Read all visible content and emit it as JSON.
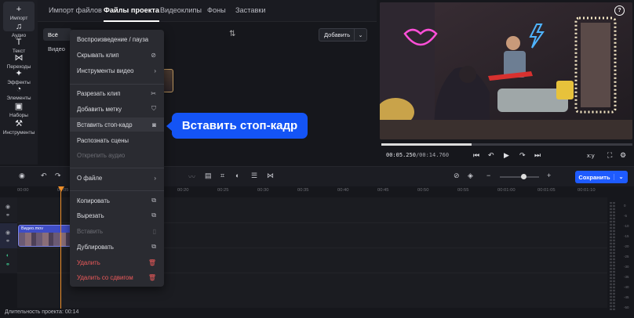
{
  "sidebar": {
    "items": [
      {
        "label": "Импорт",
        "icon": "plus-icon",
        "glyph": "+"
      },
      {
        "label": "Аудио",
        "icon": "music-note-icon",
        "glyph": "♫"
      },
      {
        "label": "Текст",
        "icon": "text-icon",
        "glyph": "T"
      },
      {
        "label": "Переходы",
        "icon": "transitions-icon",
        "glyph": "⋈"
      },
      {
        "label": "Эффекты",
        "icon": "effects-icon",
        "glyph": "✦"
      },
      {
        "label": "Элементы",
        "icon": "elements-icon",
        "glyph": "◔"
      },
      {
        "label": "Наборы",
        "icon": "sets-icon",
        "glyph": "▣"
      },
      {
        "label": "Инструменты",
        "icon": "tools-icon",
        "glyph": "⚒"
      }
    ]
  },
  "topnav": {
    "tabs": [
      "Импорт файлов",
      "Файлы проекта",
      "Видеоклипы",
      "Фоны",
      "Заставки"
    ],
    "active": 1
  },
  "library": {
    "filter": "Всё",
    "video_label": "Видео",
    "add_button": "Добавить"
  },
  "context_menu": {
    "items": [
      {
        "label": "Воспроизведение / пауза",
        "icon": ""
      },
      {
        "label": "Скрывать клип",
        "icon": "⊘"
      },
      {
        "label": "Инструменты видео",
        "icon": "›"
      },
      {
        "label": "Разрезать клип",
        "icon": "✂"
      },
      {
        "label": "Добавить метку",
        "icon": "⛉"
      },
      {
        "label": "Вставить стоп-кадр",
        "icon": "◙"
      },
      {
        "label": "Распознать сцены",
        "icon": ""
      },
      {
        "label": "Открепить аудио",
        "icon": ""
      },
      {
        "label": "О файле",
        "icon": "›"
      },
      {
        "label": "Копировать",
        "icon": "⧉"
      },
      {
        "label": "Вырезать",
        "icon": "⧉"
      },
      {
        "label": "Вставить",
        "icon": "▯"
      },
      {
        "label": "Дублировать",
        "icon": "⧉"
      },
      {
        "label": "Удалить",
        "icon": "🗑"
      },
      {
        "label": "Удалить со сдвигом",
        "icon": "🗑"
      }
    ]
  },
  "tooltip": "Вставить стоп-кадр",
  "player": {
    "timecode_current": "00:05.250",
    "timecode_total": "00:14.760",
    "aspect": "x:y",
    "progress": 0.36
  },
  "timeline": {
    "save_label": "Сохранить",
    "ruler": [
      "00:00",
      "00:05",
      "00:10",
      "00:15",
      "00:20",
      "00:25",
      "00:30",
      "00:35",
      "00:40",
      "00:45",
      "00:50",
      "00:55",
      "00:01:00",
      "00:01:05",
      "00:01:10"
    ],
    "clip_name": "Видео.mov",
    "zoom_level": 0.6
  },
  "status": "Длительность проекта: 00:14",
  "meter_labels": [
    "0",
    "-5",
    "-10",
    "-15",
    "-20",
    "-25",
    "-30",
    "-35",
    "-40",
    "-45",
    "-50"
  ]
}
